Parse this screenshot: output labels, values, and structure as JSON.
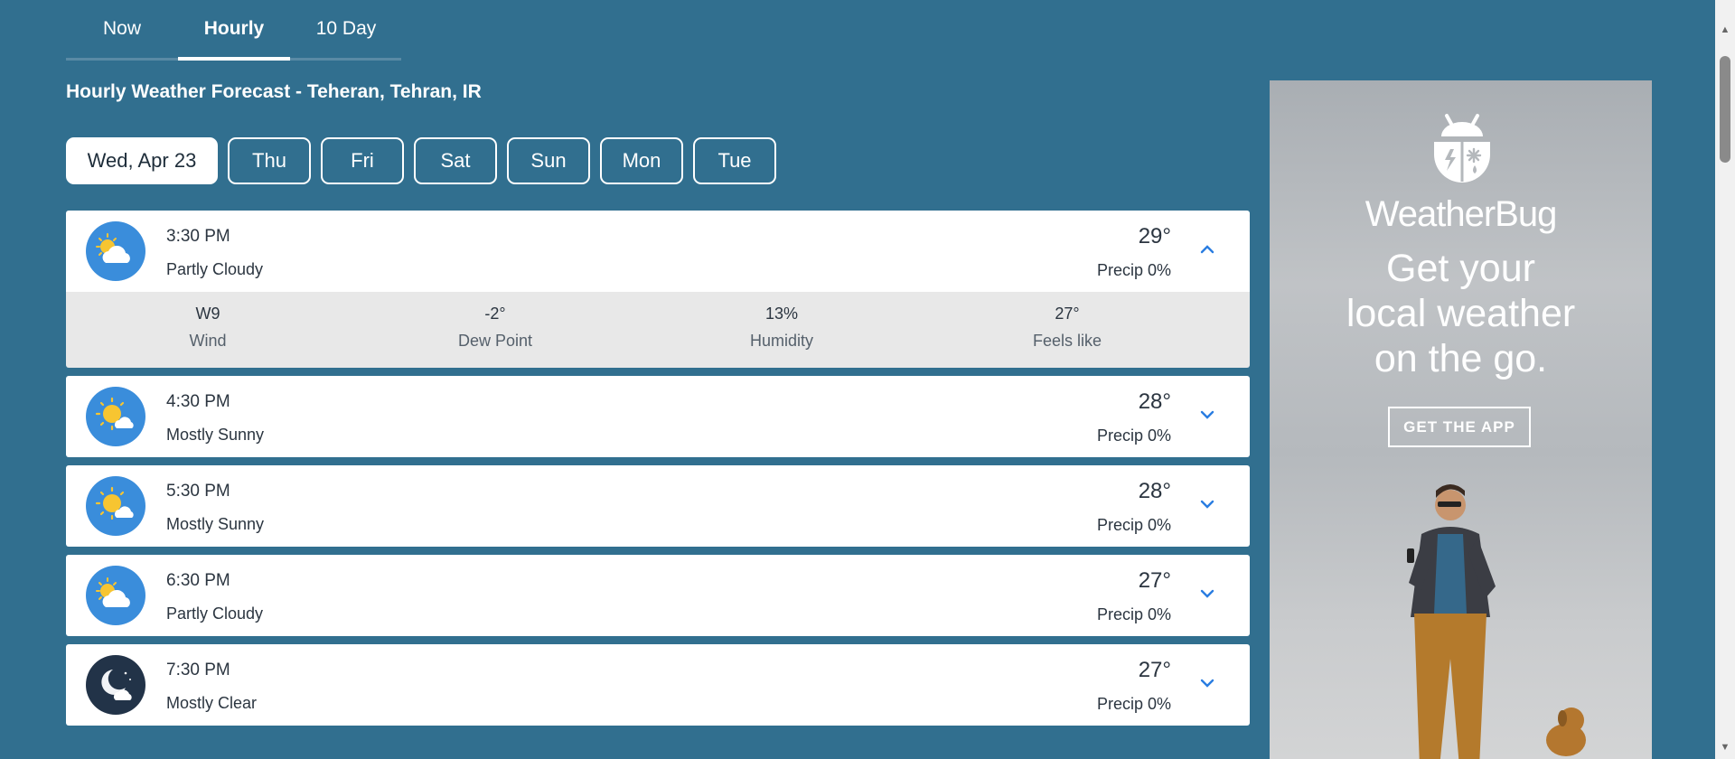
{
  "tabs": [
    {
      "label": "Now",
      "active": false
    },
    {
      "label": "Hourly",
      "active": true
    },
    {
      "label": "10 Day",
      "active": false
    }
  ],
  "page_title": "Hourly Weather Forecast - Teheran, Tehran, IR",
  "days": [
    "Wed, Apr 23",
    "Thu",
    "Fri",
    "Sat",
    "Sun",
    "Mon",
    "Tue"
  ],
  "selected_day": "Wed, Apr 23",
  "hours": [
    {
      "time": "3:30 PM",
      "condition": "Partly Cloudy",
      "temp": "29°",
      "precip": "Precip 0%",
      "icon": "partly-cloudy-day-icon",
      "expanded": true
    },
    {
      "time": "4:30 PM",
      "condition": "Mostly Sunny",
      "temp": "28°",
      "precip": "Precip 0%",
      "icon": "mostly-sunny-icon",
      "expanded": false
    },
    {
      "time": "5:30 PM",
      "condition": "Mostly Sunny",
      "temp": "28°",
      "precip": "Precip 0%",
      "icon": "mostly-sunny-icon",
      "expanded": false
    },
    {
      "time": "6:30 PM",
      "condition": "Partly Cloudy",
      "temp": "27°",
      "precip": "Precip 0%",
      "icon": "partly-cloudy-day-icon",
      "expanded": false
    },
    {
      "time": "7:30 PM",
      "condition": "Mostly Clear",
      "temp": "27°",
      "precip": "Precip 0%",
      "icon": "mostly-clear-night-icon",
      "expanded": false
    }
  ],
  "details": [
    {
      "value": "W9",
      "label": "Wind"
    },
    {
      "value": "-2°",
      "label": "Dew Point"
    },
    {
      "value": "13%",
      "label": "Humidity"
    },
    {
      "value": "27°",
      "label": "Feels like"
    }
  ],
  "ad": {
    "brand": "WeatherBug",
    "line1": "Get your",
    "line2": "local weather",
    "line3": "on the go.",
    "button": "GET THE APP"
  },
  "colors": {
    "background": "#316f8f",
    "icon_day": "#3a8ddb",
    "icon_night": "#223348",
    "chevron": "#2a7de1"
  }
}
